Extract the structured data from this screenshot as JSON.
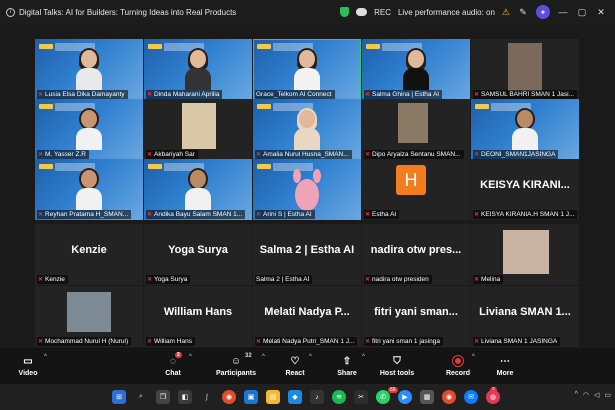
{
  "window": {
    "title": "Digital Talks: AI for Builders: Turning Ideas into Real Products",
    "rec_label": "REC",
    "live_label": "Live performance audio: on",
    "warning_glyph": "⚠",
    "minimize": "—",
    "maximize": "▢",
    "close": "✕"
  },
  "participants": [
    {
      "name": "Lusia Elsa Dika Damayanty",
      "kind": "video"
    },
    {
      "name": "Dinda Maharani Aprilia",
      "kind": "video"
    },
    {
      "name": "Grace_Telkom AI Connect",
      "kind": "video",
      "speaking": true
    },
    {
      "name": "Salma Ghina | Estha AI",
      "kind": "video"
    },
    {
      "name": "SAMSUL BAHRI SMAN 1 Jasi...",
      "kind": "photo"
    },
    {
      "name": "M. Yasser Z.R",
      "kind": "video"
    },
    {
      "name": "Akbariyah Sar",
      "kind": "photo"
    },
    {
      "name": "Amalia Nurul Husna_SMAN...",
      "kind": "video"
    },
    {
      "name": "Dipo Aryalza Sentanu SMAN...",
      "kind": "photo"
    },
    {
      "name": "DEONI_SMAN1JASINGA",
      "kind": "video"
    },
    {
      "name": "Reyhan Pratama H_SMAN...",
      "kind": "video"
    },
    {
      "name": "Andika Bayu Salam SMAN 1...",
      "kind": "video"
    },
    {
      "name": "Arini S | Estha AI",
      "kind": "video"
    },
    {
      "name": "Estha AI",
      "kind": "avatar",
      "initial": "H"
    },
    {
      "name": "KEISYA KIRANIA.H SMAN 1 J...",
      "big": "KEISYA KIRANI...",
      "kind": "text"
    },
    {
      "name": "Kenzie",
      "big": "Kenzie",
      "kind": "text"
    },
    {
      "name": "Yoga Surya",
      "big": "Yoga Surya",
      "kind": "text"
    },
    {
      "name": "Salma 2 | Estha AI",
      "big": "Salma 2 | Estha AI",
      "kind": "text"
    },
    {
      "name": "nadira otw presiden",
      "big": "nadira otw pres...",
      "kind": "text"
    },
    {
      "name": "Melina",
      "kind": "photo"
    },
    {
      "name": "Mochammad Nurul H (Nurul)",
      "kind": "photo"
    },
    {
      "name": "William Hans",
      "big": "William Hans",
      "kind": "text"
    },
    {
      "name": "Melati Nadya Putri_SMAN 1 J...",
      "big": "Melati Nadya P...",
      "kind": "text"
    },
    {
      "name": "fitri yani sman 1 jasinga",
      "big": "fitri yani sman...",
      "kind": "text"
    },
    {
      "name": "Liviana SMAN 1 JASINGA",
      "big": "Liviana SMAN 1...",
      "kind": "text"
    }
  ],
  "toolbar": {
    "video": "Video",
    "chat": "Chat",
    "chat_badge": "2",
    "participants": "Participants",
    "participants_count": "32",
    "react": "React",
    "share": "Share",
    "host_tools": "Host tools",
    "record": "Record",
    "more": "More"
  },
  "taskbar": {
    "badge_whatsapp": "66",
    "badge_app": "2"
  },
  "colors": {
    "speaking": "#2ecc71",
    "mic_off": "#e53935",
    "avatar": "#f27c1e",
    "banner": "#2f7fd0"
  }
}
